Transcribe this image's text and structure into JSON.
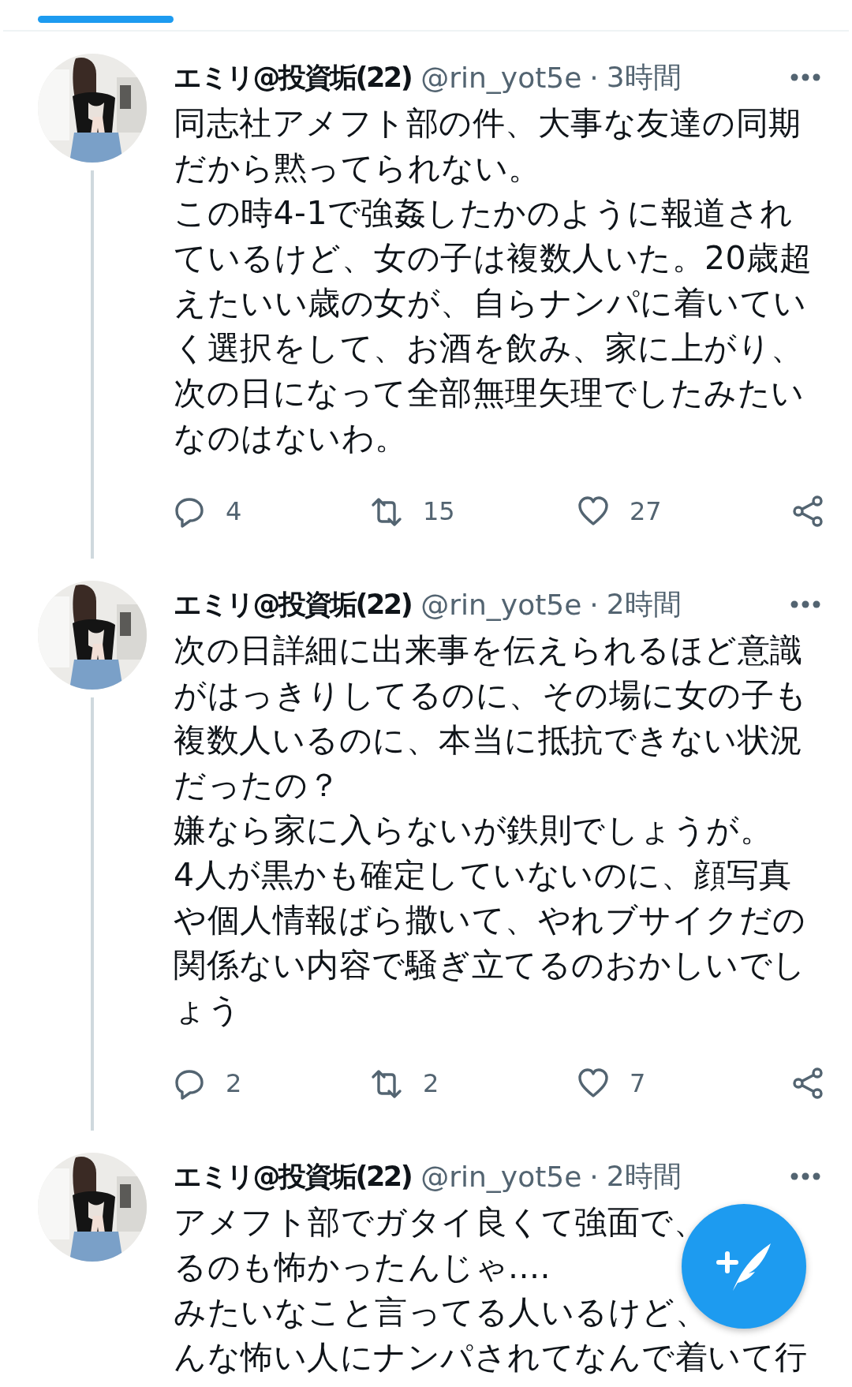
{
  "tweets": [
    {
      "name": "エミリ@投資垢(22)",
      "handle": "@rin_yot5e",
      "separator": "·",
      "time": "3時間",
      "thread": true,
      "lines": [
        "同志社アメフト部の件、大事な友達の同期",
        "だから黙ってられない。",
        "この時4-1で強姦したかのように報道され",
        "ているけど、女の子は複数人いた。20歳超",
        "えたいい歳の女が、自らナンパに着いてい",
        "く選択をして、お酒を飲み、家に上がり、",
        "次の日になって全部無理矢理でしたみたい",
        "なのはないわ。"
      ],
      "replies": "4",
      "retweets": "15",
      "likes": "27"
    },
    {
      "name": "エミリ@投資垢(22)",
      "handle": "@rin_yot5e",
      "separator": "·",
      "time": "2時間",
      "thread": true,
      "lines": [
        "次の日詳細に出来事を伝えられるほど意識",
        "がはっきりしてるのに、その場に女の子も",
        "複数人いるのに、本当に抵抗できない状況",
        "だったの？",
        "嫌なら家に入らないが鉄則でしょうが。",
        "4人が黒かも確定していないのに、顔写真",
        "や個人情報ばら撒いて、やれブサイクだの",
        "関係ない内容で騒ぎ立てるのおかしいでし",
        "ょう"
      ],
      "replies": "2",
      "retweets": "2",
      "likes": "7"
    },
    {
      "name": "エミリ@投資垢(22)",
      "handle": "@rin_yot5e",
      "separator": "·",
      "time": "2時間",
      "thread": false,
      "lines": [
        "アメフト部でガタイ良くて強面で、",
        "るのも怖かったんじゃ....",
        "みたいなこと言ってる人いるけど、",
        "んな怖い人にナンパされてなんで着いて行"
      ]
    }
  ]
}
